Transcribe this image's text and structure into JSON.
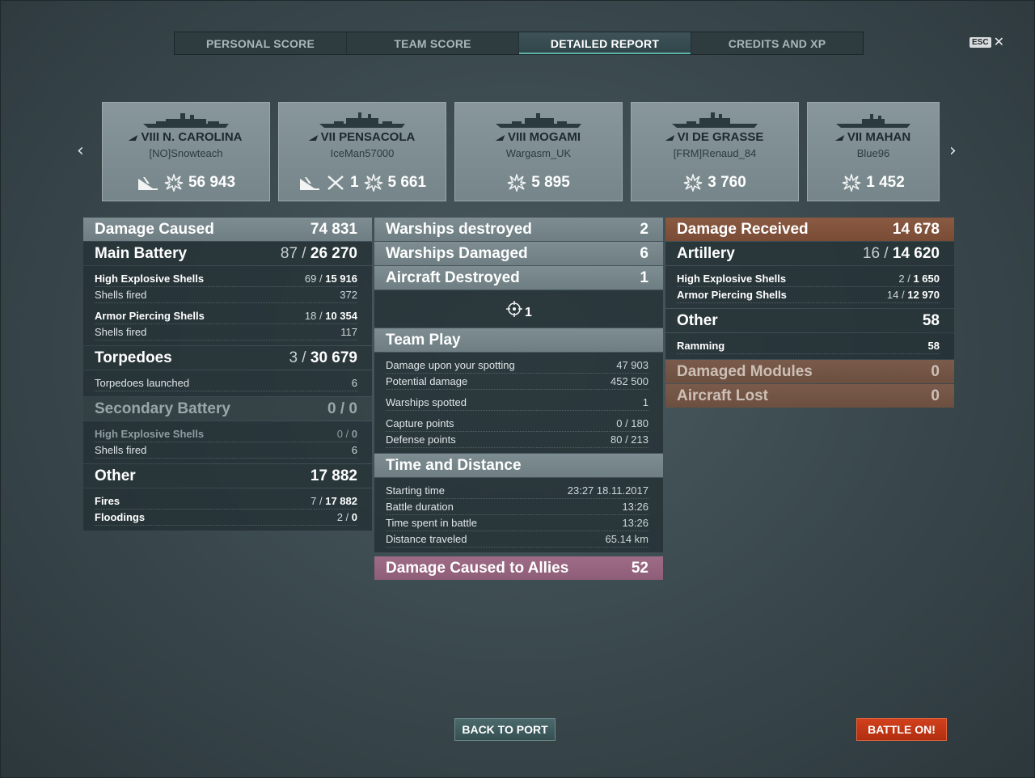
{
  "tabs": [
    {
      "label": "PERSONAL SCORE",
      "active": false
    },
    {
      "label": "TEAM SCORE",
      "active": false
    },
    {
      "label": "DETAILED REPORT",
      "active": true
    },
    {
      "label": "CREDITS AND XP",
      "active": false
    }
  ],
  "close": {
    "key_label": "ESC",
    "symbol": "✕"
  },
  "carousel": {
    "prev_arrow": "‹",
    "next_arrow": "›",
    "ships": [
      {
        "name": "VIII N. CAROLINA",
        "player": "[NO]Snowteach",
        "damage": "56 943",
        "icons": [
          "sunk-ship-icon",
          "damage-explosion-icon"
        ]
      },
      {
        "name": "VII PENSACOLA",
        "player": "IceMan57000",
        "kills": "1",
        "damage": "5 661",
        "icons": [
          "sunk-ship-icon",
          "aircraft-shot-icon",
          "damage-explosion-icon"
        ]
      },
      {
        "name": "VIII MOGAMI",
        "player": "Wargasm_UK",
        "damage": "5 895",
        "icons": [
          "damage-explosion-icon"
        ]
      },
      {
        "name": "VI DE GRASSE",
        "player": "[FRM]Renaud_84",
        "damage": "3 760",
        "icons": [
          "damage-explosion-icon"
        ]
      },
      {
        "name": "VII MAHAN",
        "player": "Blue96",
        "damage": "1 452",
        "icons": [
          "damage-explosion-icon"
        ]
      }
    ]
  },
  "damage_caused": {
    "title": "Damage Caused",
    "value": "74 831",
    "main_battery": {
      "title": "Main Battery",
      "hits": "87",
      "damage": "26 270"
    },
    "he_shells": {
      "label": "High Explosive Shells",
      "hits": "69",
      "damage": "15 916"
    },
    "he_fired": {
      "label": "Shells fired",
      "value": "372"
    },
    "ap_shells": {
      "label": "Armor Piercing Shells",
      "hits": "18",
      "damage": "10 354"
    },
    "ap_fired": {
      "label": "Shells fired",
      "value": "117"
    },
    "torpedoes": {
      "title": "Torpedoes",
      "hits": "3",
      "damage": "30 679"
    },
    "torp_launched": {
      "label": "Torpedoes launched",
      "value": "6"
    },
    "secondary": {
      "title": "Secondary Battery",
      "hits": "0",
      "damage": "0"
    },
    "sec_he": {
      "label": "High Explosive Shells",
      "hits": "0",
      "damage": "0"
    },
    "sec_fired": {
      "label": "Shells fired",
      "value": "6"
    },
    "other": {
      "title": "Other",
      "value": "17 882"
    },
    "fires": {
      "label": "Fires",
      "hits": "7",
      "damage": "17 882"
    },
    "floodings": {
      "label": "Floodings",
      "hits": "2",
      "damage": "0"
    }
  },
  "combat": {
    "warships_destroyed": {
      "label": "Warships destroyed",
      "value": "2"
    },
    "warships_damaged": {
      "label": "Warships Damaged",
      "value": "6"
    },
    "aircraft_destroyed": {
      "label": "Aircraft Destroyed",
      "value": "1"
    },
    "spotted_aircraft": "1"
  },
  "team_play": {
    "title": "Team Play",
    "rows": [
      {
        "label": "Damage upon your spotting",
        "value": "47 903"
      },
      {
        "label": "Potential damage",
        "value": "452 500"
      },
      {
        "label": "Warships spotted",
        "value": "1"
      },
      {
        "label": "Capture points",
        "value": "0 / 180"
      },
      {
        "label": "Defense points",
        "value": "80 / 213"
      }
    ]
  },
  "time_distance": {
    "title": "Time and Distance",
    "rows": [
      {
        "label": "Starting time",
        "value": "23:27  18.11.2017"
      },
      {
        "label": "Battle duration",
        "value": "13:26"
      },
      {
        "label": "Time spent in battle",
        "value": "13:26"
      },
      {
        "label": "Distance traveled",
        "value": "65.14 km"
      }
    ]
  },
  "allies_damage": {
    "label": "Damage Caused to Allies",
    "value": "52"
  },
  "damage_received": {
    "title": "Damage Received",
    "value": "14 678",
    "artillery": {
      "title": "Artillery",
      "hits": "16",
      "damage": "14 620"
    },
    "he_shells": {
      "label": "High Explosive Shells",
      "hits": "2",
      "damage": "1 650"
    },
    "ap_shells": {
      "label": "Armor Piercing Shells",
      "hits": "14",
      "damage": "12 970"
    },
    "other": {
      "title": "Other",
      "value": "58"
    },
    "ramming": {
      "label": "Ramming",
      "value": "58"
    },
    "modules": {
      "label": "Damaged Modules",
      "value": "0"
    },
    "aircraft_lost": {
      "label": "Aircraft Lost",
      "value": "0"
    }
  },
  "buttons": {
    "back": "BACK TO PORT",
    "battle": "BATTLE ON!"
  },
  "colors": {
    "accent_teal": "#5fb3a8",
    "battle_orange": "#d2401c",
    "received_brown": "#8a5a42",
    "allies_pink": "#9e6c86"
  }
}
